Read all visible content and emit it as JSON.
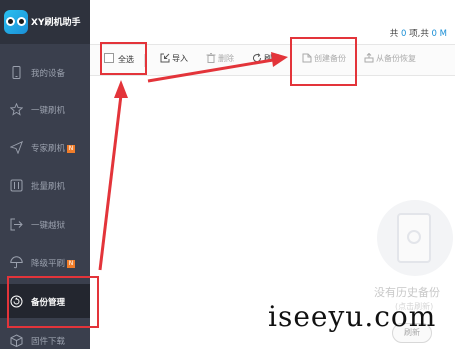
{
  "app": {
    "title": "XY刷机助手"
  },
  "sidebar": {
    "items": [
      {
        "label": "我的设备",
        "icon": "phone-icon"
      },
      {
        "label": "一键刷机",
        "icon": "star-icon"
      },
      {
        "label": "专家刷机",
        "icon": "send-icon",
        "badge": "N"
      },
      {
        "label": "批量刷机",
        "icon": "grid-icon"
      },
      {
        "label": "一键越狱",
        "icon": "exit-icon"
      },
      {
        "label": "降级平刷",
        "icon": "umbrella-icon",
        "badge": "N"
      },
      {
        "label": "备份管理",
        "icon": "backup-icon",
        "active": true
      },
      {
        "label": "固件下载",
        "icon": "box-icon"
      }
    ]
  },
  "header": {
    "count_prefix": "共",
    "item_count": "0",
    "count_mid": "项,共",
    "size": "0 M"
  },
  "toolbar": {
    "select_all": "全选",
    "import": "导入",
    "delete": "删除",
    "refresh": "刷新",
    "create_backup": "创建备份",
    "restore_from_backup": "从备份恢复"
  },
  "empty_state": {
    "title": "没有历史备份",
    "subtitle": "(点击刷新)",
    "refresh_button": "刷新"
  },
  "watermark": "iseeyu.com",
  "colors": {
    "sidebar": "#3a3f4d",
    "sidebar_active": "#23262f",
    "accent": "#1a8fd6",
    "badge": "#f07d2a",
    "annotation": "#e3343a"
  }
}
